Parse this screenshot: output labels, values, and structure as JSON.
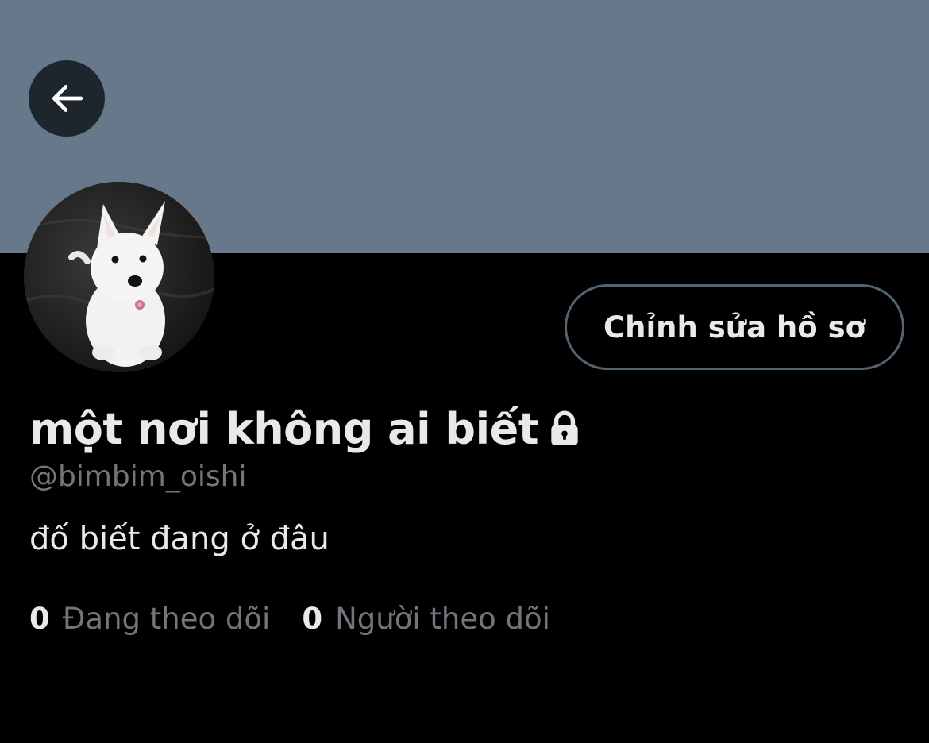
{
  "colors": {
    "banner": "#66788a",
    "background": "#000000",
    "text_primary": "#e7e9ea",
    "text_secondary": "#71767b",
    "button_border": "#536471"
  },
  "header": {
    "back_icon": "arrow-left-icon"
  },
  "profile": {
    "avatar": "white-puppy-photo",
    "edit_button_label": "Chỉnh sửa hồ sơ",
    "display_name": "một nơi không ai biết",
    "protected_icon": "lock-icon",
    "handle": "@bimbim_oishi",
    "bio": "đố biết đang ở đâu"
  },
  "stats": {
    "following_count": "0",
    "following_label": "Đang theo dõi",
    "followers_count": "0",
    "followers_label": "Người theo dõi"
  }
}
